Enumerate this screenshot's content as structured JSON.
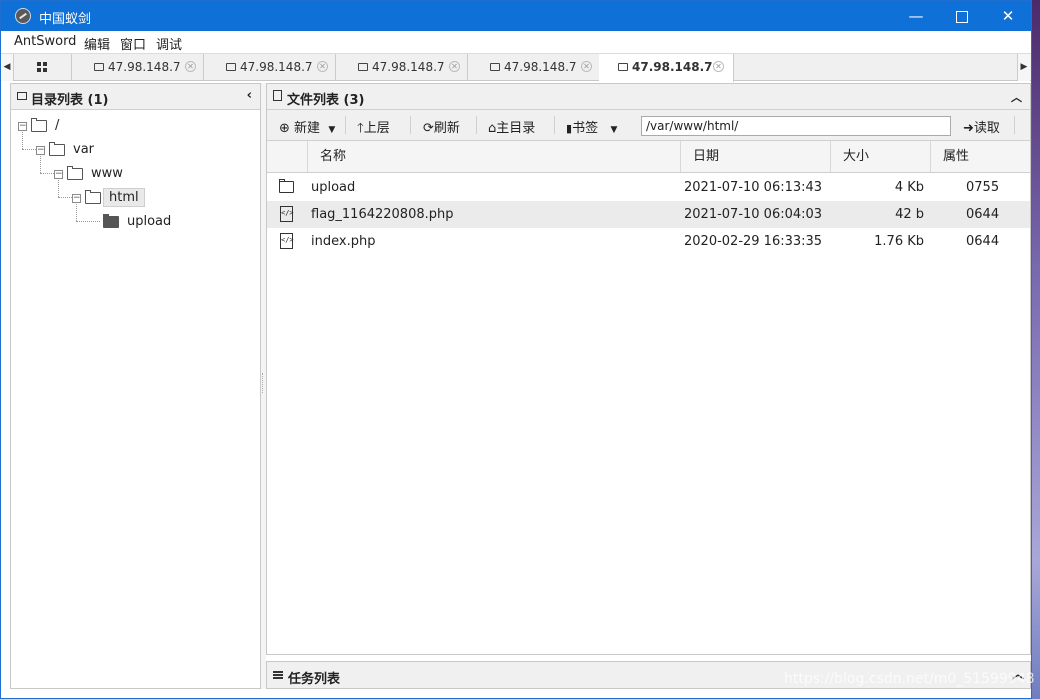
{
  "window": {
    "title": "中国蚁剑"
  },
  "menu": [
    "AntSword",
    "编辑",
    "窗口",
    "调试"
  ],
  "tabs": [
    {
      "label": "47.98.148.7",
      "active": false
    },
    {
      "label": "47.98.148.7",
      "active": false
    },
    {
      "label": "47.98.148.7",
      "active": false
    },
    {
      "label": "47.98.148.7",
      "active": false
    },
    {
      "label": "47.98.148.7",
      "active": true
    }
  ],
  "dir_panel": {
    "title": "目录列表 (1)",
    "tree": [
      {
        "label": "/",
        "depth": 0
      },
      {
        "label": "var",
        "depth": 1
      },
      {
        "label": "www",
        "depth": 2
      },
      {
        "label": "html",
        "depth": 3,
        "selected": true
      },
      {
        "label": "upload",
        "depth": 4
      }
    ]
  },
  "file_panel": {
    "title": "文件列表 (3)",
    "toolbar": {
      "new_label": "新建",
      "up_label": "上层",
      "refresh_label": "刷新",
      "home_label": "主目录",
      "bookmark_label": "书签",
      "path_value": "/var/www/html/",
      "read_label": "读取"
    },
    "columns": [
      "名称",
      "日期",
      "大小",
      "属性"
    ],
    "rows": [
      {
        "icon": "folder-icon",
        "name": "upload",
        "date": "2021-07-10 06:13:43",
        "size": "4 Kb",
        "perm": "0755"
      },
      {
        "icon": "code-file-icon",
        "name": "flag_1164220808.php",
        "date": "2021-07-10 06:04:03",
        "size": "42 b",
        "perm": "0644"
      },
      {
        "icon": "code-file-icon",
        "name": "index.php",
        "date": "2020-02-29 16:33:35",
        "size": "1.76 Kb",
        "perm": "0644"
      }
    ]
  },
  "task_panel": {
    "title": "任务列表"
  },
  "watermark": "https://blog.csdn.net/m0_51599948"
}
